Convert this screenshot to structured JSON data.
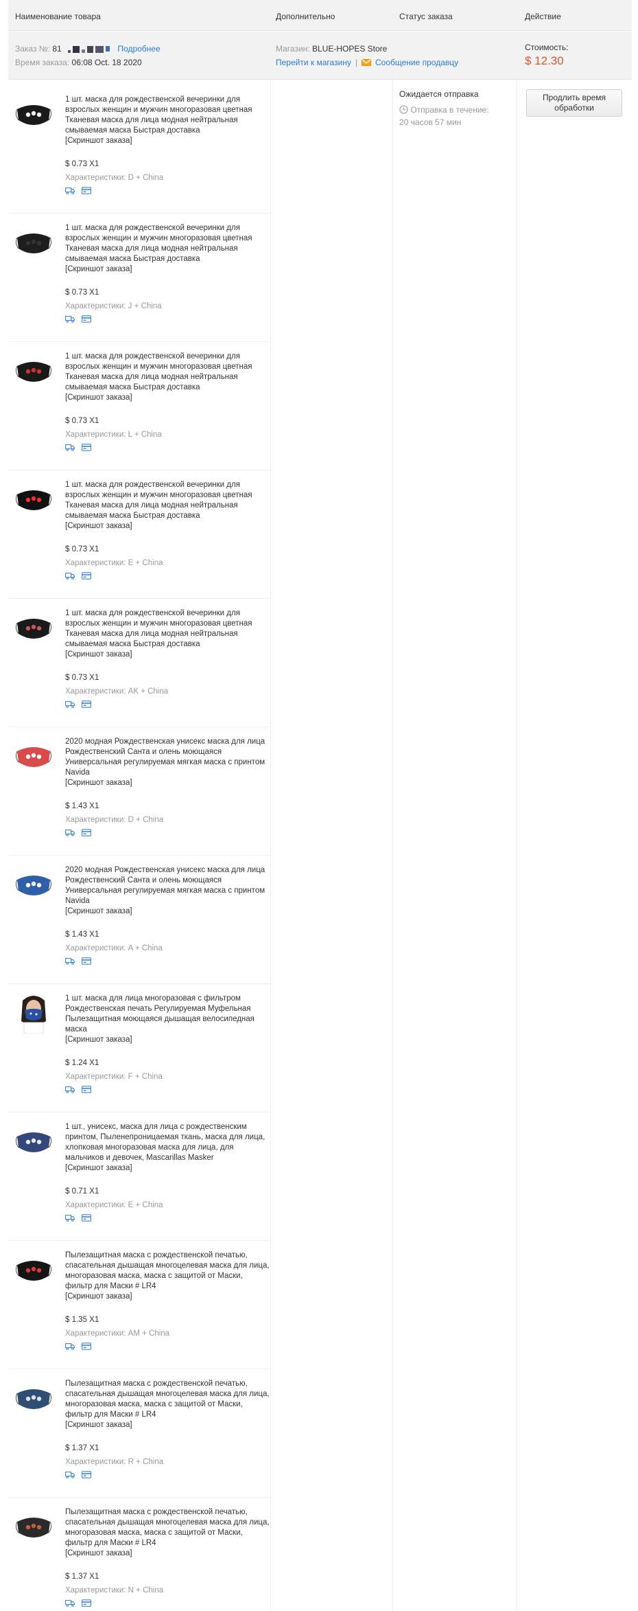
{
  "header": {
    "col_name": "Наименование товара",
    "col_extra": "Дополнительно",
    "col_status": "Статус заказа",
    "col_action": "Действие"
  },
  "order": {
    "number_label": "Заказ №:",
    "number_prefix": "81",
    "details_link": "Подробнее",
    "time_label": "Время заказа:",
    "time_value": "06:08 Oct. 18 2020",
    "store_label": "Магазин:",
    "store_name": "BLUE-HOPES Store",
    "goto_store": "Перейти к магазину",
    "separator": "|",
    "message_seller": "Сообщение продавцу",
    "cost_label": "Стоимость:",
    "cost_value": "$ 12.30"
  },
  "status": {
    "title": "Ожидается отправка",
    "ship_label": "Отправка в течение:",
    "ship_time": "20 часов 57 мин"
  },
  "action": {
    "extend_button": "Продлить время обработки"
  },
  "items": [
    {
      "title": "1 шт. маска для рождественской вечеринки для взрослых женщин и мужчин многоразовая цветная Тканевая маска для лица модная нейтральная смываемая маска Быстрая доставка",
      "snapshot": "[Скриншот заказа]",
      "price": "$ 0.73 X1",
      "props": "Характеристики: D + China"
    },
    {
      "title": "1 шт. маска для рождественской вечеринки для взрослых женщин и мужчин многоразовая цветная Тканевая маска для лица модная нейтральная смываемая маска Быстрая доставка",
      "snapshot": "[Скриншот заказа]",
      "price": "$ 0.73 X1",
      "props": "Характеристики: J + China"
    },
    {
      "title": "1 шт. маска для рождественской вечеринки для взрослых женщин и мужчин многоразовая цветная Тканевая маска для лица модная нейтральная смываемая маска Быстрая доставка",
      "snapshot": "[Скриншот заказа]",
      "price": "$ 0.73 X1",
      "props": "Характеристики: L + China"
    },
    {
      "title": "1 шт. маска для рождественской вечеринки для взрослых женщин и мужчин многоразовая цветная Тканевая маска для лица модная нейтральная смываемая маска Быстрая доставка",
      "snapshot": "[Скриншот заказа]",
      "price": "$ 0.73 X1",
      "props": "Характеристики: E + China"
    },
    {
      "title": "1 шт. маска для рождественской вечеринки для взрослых женщин и мужчин многоразовая цветная Тканевая маска для лица модная нейтральная смываемая маска Быстрая доставка",
      "snapshot": "[Скриншот заказа]",
      "price": "$ 0.73 X1",
      "props": "Характеристики: AK + China"
    },
    {
      "title": "2020 модная Рождественская унисекс маска для лица Рождественский Санта и олень моющаяся Универсальная регулируемая мягкая маска с принтом Navida",
      "snapshot": "[Скриншот заказа]",
      "price": "$ 1.43 X1",
      "props": "Характеристики: D + China"
    },
    {
      "title": "2020 модная Рождественская унисекс маска для лица Рождественский Санта и олень моющаяся Универсальная регулируемая мягкая маска с принтом Navida",
      "snapshot": "[Скриншот заказа]",
      "price": "$ 1.43 X1",
      "props": "Характеристики: A + China"
    },
    {
      "title": "1 шт. маска для лица многоразовая с фильтром Рождественская печать Регулируемая Муфельная Пылезащитная моющаяся дышащая велосипедная маска",
      "snapshot": "[Скриншот заказа]",
      "price": "$ 1.24 X1",
      "props": "Характеристики: F + China"
    },
    {
      "title": "1 шт., унисекс, маска для лица с рождественским принтом, Пыленепроницаемая ткань, маска для лица, хлопковая многоразовая маска для лица, для мальчиков и девочек, Mascarillas Masker",
      "snapshot": "[Скриншот заказа]",
      "price": "$ 0.71 X1",
      "props": "Характеристики: E + China"
    },
    {
      "title": "Пылезащитная маска с рождественской печатью, спасательная дышащая многоцелевая маска для лица, многоразовая маска, маска с защитой от Маски, фильтр для Маски # LR4",
      "snapshot": "[Скриншот заказа]",
      "price": "$ 1.35 X1",
      "props": "Характеристики: AM + China"
    },
    {
      "title": "Пылезащитная маска с рождественской печатью, спасательная дышащая многоцелевая маска для лица, многоразовая маска, маска с защитой от Маски, фильтр для Маски # LR4",
      "snapshot": "[Скриншот заказа]",
      "price": "$ 1.37 X1",
      "props": "Характеристики: R + China"
    },
    {
      "title": "Пылезащитная маска с рождественской печатью, спасательная дышащая многоцелевая маска для лица, многоразовая маска, маска с защитой от Маски, фильтр для Маски # LR4",
      "snapshot": "[Скриншот заказа]",
      "price": "$ 1.37 X1",
      "props": "Характеристики: N + China"
    }
  ]
}
